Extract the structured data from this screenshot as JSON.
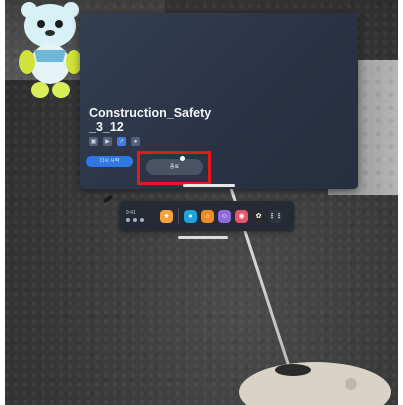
{
  "scene": {
    "panel": {
      "title": "Construction_Safety\n_3_12",
      "primary_button_label": "다시 시작",
      "secondary_button_label": "종료",
      "icons": [
        "camera-icon",
        "video-icon",
        "share-icon",
        "lock-icon"
      ]
    },
    "taskbar": {
      "time": "9:41",
      "apps": [
        {
          "name": "store-app",
          "color": "#f2a33a"
        },
        {
          "name": "quest-store-app",
          "color": "#1fa3d9"
        },
        {
          "name": "home-app",
          "color": "#ef8c21"
        },
        {
          "name": "people-app",
          "color": "#8f6be0"
        },
        {
          "name": "camera-app",
          "color": "#e8556a"
        },
        {
          "name": "media-app",
          "color": "#2a2a2a"
        },
        {
          "name": "apps-grid",
          "color": "#2f3440"
        }
      ]
    },
    "highlight_color": "#e11b1b"
  }
}
